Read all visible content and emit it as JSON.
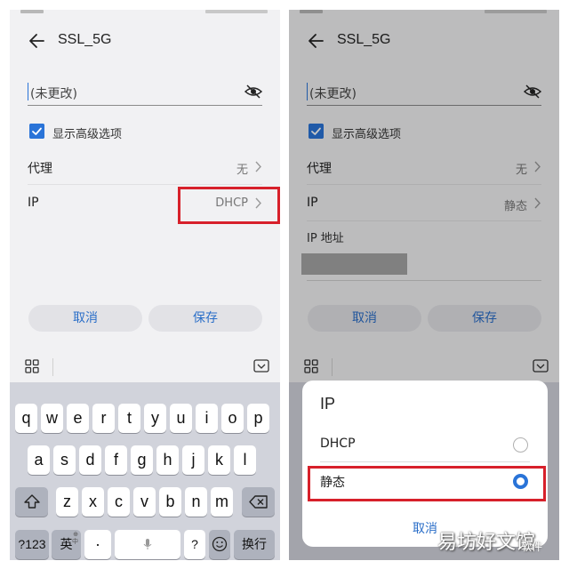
{
  "left": {
    "title": "SSL_5G",
    "password_placeholder": "(未更改)",
    "advanced_label": "显示高级选项",
    "proxy_label": "代理",
    "proxy_value": "无",
    "ip_label": "IP",
    "ip_value": "DHCP",
    "cancel_label": "取消",
    "save_label": "保存"
  },
  "right": {
    "title": "SSL_5G",
    "password_placeholder": "(未更改)",
    "advanced_label": "显示高级选项",
    "proxy_label": "代理",
    "proxy_value": "无",
    "ip_label": "IP",
    "ip_value": "静态",
    "ip_address_label": "IP 地址",
    "cancel_label": "取消",
    "save_label": "保存"
  },
  "keyboard": {
    "row1": [
      "q",
      "w",
      "e",
      "r",
      "t",
      "y",
      "u",
      "i",
      "o",
      "p"
    ],
    "row2": [
      "a",
      "s",
      "d",
      "f",
      "g",
      "h",
      "j",
      "k",
      "l"
    ],
    "row3": [
      "z",
      "x",
      "c",
      "v",
      "b",
      "n",
      "m"
    ],
    "num_label": "?123",
    "lang_label": "英",
    "lang_sub": "中",
    "lang_sub_top": "⊕",
    "dot_label": "·",
    "question_label": "?",
    "return_label": "换行"
  },
  "dialog": {
    "title": "IP",
    "options": [
      "DHCP",
      "静态"
    ],
    "selected": "静态",
    "cancel_label": "取消"
  },
  "watermark": {
    "text": "易坊好文馆",
    "small": "软件"
  },
  "colors": {
    "accent": "#2a74d8",
    "highlight": "#d7202a",
    "link": "#2a6ec8"
  }
}
